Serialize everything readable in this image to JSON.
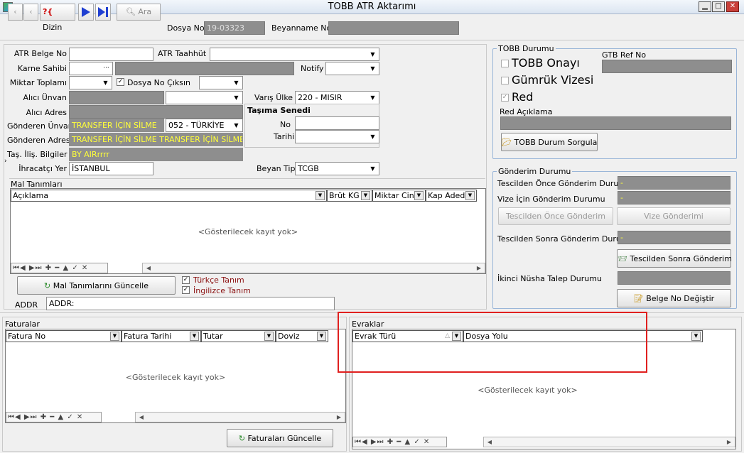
{
  "window": {
    "title": "TOBB ATR Aktarımı",
    "min": "▁",
    "max": "□",
    "close": "✕"
  },
  "toolbar": {
    "dizin": "Dizin",
    "ara": "Ara",
    "dosya_no_label": "Dosya No",
    "dosya_no_value": "19-03323",
    "beyanname_no_label": "Beyanname No",
    "beyanname_no_value": "",
    "help": "?{"
  },
  "form": {
    "atr_belge_no": {
      "label": "ATR Belge No",
      "value": ""
    },
    "atr_taahhut": {
      "label": "ATR Taahhüt",
      "value": ""
    },
    "karne_sahibi": {
      "label": "Karne Sahibi",
      "value": "",
      "dots": "···"
    },
    "notify": {
      "label": "Notify",
      "value": ""
    },
    "miktar_toplami": {
      "label": "Miktar Toplamı",
      "value": ""
    },
    "dosya_no_ciksin": {
      "label": "Dosya No Çıksın",
      "checked": true,
      "value": ""
    },
    "alici_unvan": {
      "label": "Alıcı Ünvan",
      "value": ""
    },
    "varis_ulke": {
      "label": "Varış Ülke",
      "value": "220 - MISIR"
    },
    "alici_adres": {
      "label": "Alıcı Adres",
      "value": ""
    },
    "tasima_senedi": "Taşıma Senedi",
    "gonderen_unvan": {
      "label": "Gönderen Ünvan",
      "value": "TRANSFER İÇİN SİLME",
      "country": "052 - TÜRKİYE"
    },
    "gonderen_adres": {
      "label": "Gönderen Adres",
      "value": "TRANSFER İÇİN SİLME TRANSFER İÇİN SİLME T"
    },
    "no": {
      "label": "No",
      "value": ""
    },
    "tarihi": {
      "label": "Tarihi",
      "value": ""
    },
    "tas_ilis_bilgiler": {
      "label": "Taş. İliş. Bilgiler",
      "value": "BY AIRrrrr"
    },
    "ihracatci_yer": {
      "label": "İhracatçı Yer",
      "value": "İSTANBUL"
    },
    "beyan_tipi": {
      "label": "Beyan Tipi",
      "value": "TCGB"
    }
  },
  "mal_tanimlari": {
    "title": "Mal Tanımları",
    "columns": [
      "Açıklama",
      "Brüt KG",
      "Miktar Cinsi",
      "Kap Adedi"
    ],
    "empty": "<Gösterilecek kayıt yok>",
    "nav": "⏮◀ ▶⏭ ✚ ━ ▲ ✓ ✕",
    "update_button": "Mal Tanımlarını Güncelle",
    "turkce_tanim": "Türkçe Tanım",
    "ingilizce_tanim": "İngilizce Tanım",
    "addr_label": "ADDR",
    "addr_value": "ADDR:"
  },
  "tobb_durumu": {
    "title": "TOBB Durumu",
    "gtb_ref_no": "GTB Ref No",
    "tobb_onayi": "TOBB Onayı",
    "gumruk_vizesi": "Gümrük Vizesi",
    "red": "Red",
    "red_checked": true,
    "red_aciklama": "Red Açıklama",
    "sorgula_button": "TOBB Durum Sorgula"
  },
  "gonderim_durumu": {
    "title": "Gönderim Durumu",
    "tescilden_once_durumu": "Tescilden Önce Gönderim Durumu",
    "vize_icin_durumu": "Vize İçin Gönderim Durumu",
    "tescilden_once_button": "Tescilden Önce Gönderim",
    "vize_button": "Vize Gönderimi",
    "tescilden_sonra_durumu": "Tescilden Sonra Gönderim Durumu",
    "tescilden_sonra_button": "Tescilden Sonra Gönderim",
    "ikinci_nusha": "İkinci Nüsha Talep Durumu",
    "belge_no_button": "Belge No Değiştir",
    "dash": "-"
  },
  "faturalar": {
    "title": "Faturalar",
    "columns": [
      "Fatura No",
      "Fatura Tarihi",
      "Tutar",
      "Doviz"
    ],
    "empty": "<Gösterilecek kayıt yok>",
    "nav": "⏮◀ ▶⏭ ✚ ━ ▲ ✓ ✕",
    "update_button": "Faturaları Güncelle"
  },
  "evraklar": {
    "title": "Evraklar",
    "columns": [
      "Evrak Türü",
      "Dosya Yolu"
    ],
    "empty": "<Gösterilecek kayıt yok>",
    "nav": "⏮◀ ▶⏭ ✚ ━ ▲ ✓ ✕"
  }
}
